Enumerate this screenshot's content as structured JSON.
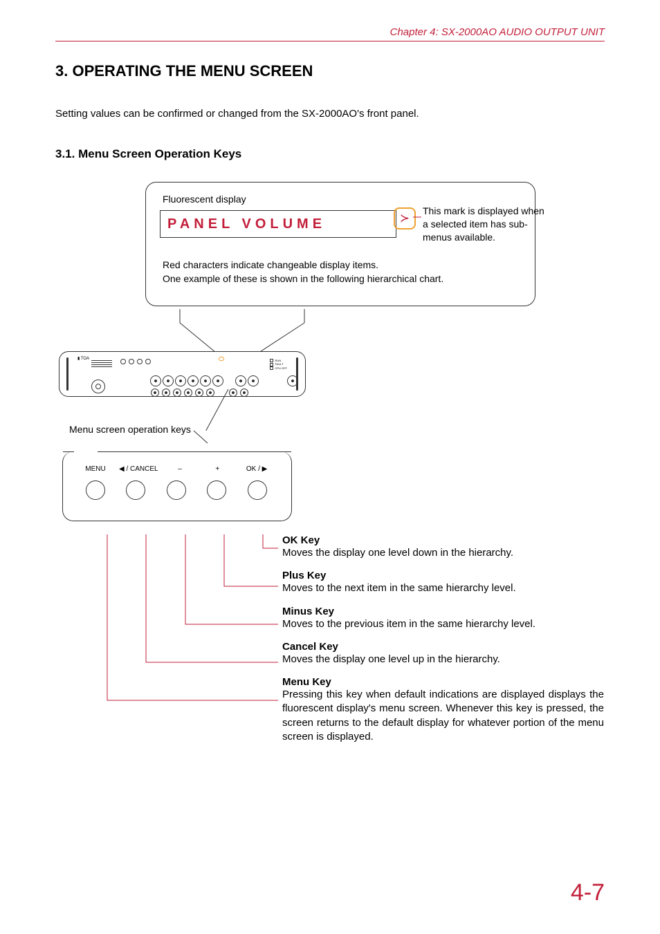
{
  "chapter": "Chapter 4:  SX-2000AO AUDIO OUTPUT UNIT",
  "h1": "3. OPERATING THE MENU SCREEN",
  "intro": "Setting values can be confirmed or changed from the SX-2000AO's front panel.",
  "h2": "3.1. Menu Screen Operation Keys",
  "fluorescent_label": "Fluorescent display",
  "vfd_text": "PANEL VOLUME",
  "submenu_mark_note": "This mark is displayed when a selected item has sub-menus available.",
  "red_note_1": "Red characters indicate changeable display items.",
  "red_note_2": "One example of these is shown in the following hierarchical chart.",
  "menu_keys_label": "Menu screen operation keys",
  "key_labels": {
    "menu": "MENU",
    "cancel": "◀ / CANCEL",
    "minus": "–",
    "plus": "+",
    "ok": "OK / ▶"
  },
  "defs": {
    "ok": {
      "title": "OK Key",
      "body": "Moves the display one level down in the hierarchy."
    },
    "plus": {
      "title": "Plus Key",
      "body": "Moves to the next item in the same hierarchy level."
    },
    "minus": {
      "title": "Minus Key",
      "body": "Moves to the previous item in the same hierarchy level."
    },
    "cancel": {
      "title": "Cancel Key",
      "body": "Moves the display one level up in the hierarchy."
    },
    "menu": {
      "title": "Menu Key",
      "body": "Pressing this key when default indications are displayed displays the fluorescent display's menu screen. Whenever this key is pressed, the screen returns to the default display for whatever portion of the menu screen is displayed."
    }
  },
  "page_number": "4-7",
  "submenu_glyph": "≻"
}
